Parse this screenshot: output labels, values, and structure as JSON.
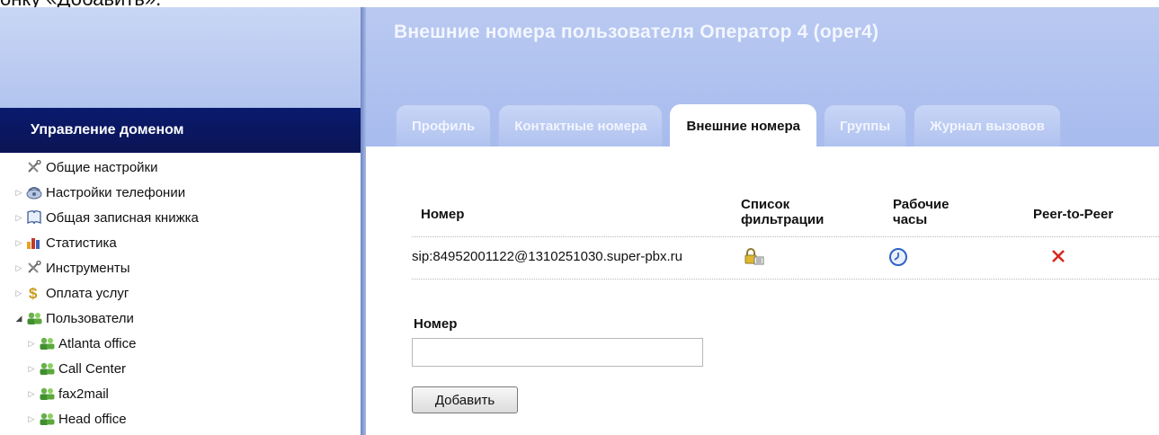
{
  "caption": "онку «Добавить».",
  "sidebar": {
    "header": "Управление доменом",
    "items": [
      {
        "label": "Общие настройки",
        "icon": "tools-icon",
        "arrow": "",
        "indent": 0
      },
      {
        "label": "Настройки телефонии",
        "icon": "telephony-icon",
        "arrow": "collapsed",
        "indent": 0
      },
      {
        "label": "Общая записная книжка",
        "icon": "address-book-icon",
        "arrow": "collapsed",
        "indent": 0
      },
      {
        "label": "Статистика",
        "icon": "statistics-icon",
        "arrow": "collapsed",
        "indent": 0
      },
      {
        "label": "Инструменты",
        "icon": "tools-icon",
        "arrow": "collapsed",
        "indent": 0
      },
      {
        "label": "Оплата услуг",
        "icon": "dollar-icon",
        "arrow": "collapsed",
        "indent": 0
      },
      {
        "label": "Пользователи",
        "icon": "users-icon",
        "arrow": "expanded",
        "indent": 0
      },
      {
        "label": "Atlanta office",
        "icon": "users-icon",
        "arrow": "collapsed",
        "indent": 1
      },
      {
        "label": "Call Center",
        "icon": "users-icon",
        "arrow": "collapsed",
        "indent": 1
      },
      {
        "label": "fax2mail",
        "icon": "users-icon",
        "arrow": "collapsed",
        "indent": 1
      },
      {
        "label": "Head office",
        "icon": "users-icon",
        "arrow": "collapsed",
        "indent": 1
      }
    ]
  },
  "main": {
    "title": "Внешние номера пользователя Оператор 4 (oper4)",
    "tabs": [
      {
        "label": "Профиль",
        "active": false
      },
      {
        "label": "Контактные номера",
        "active": false
      },
      {
        "label": "Внешние номера",
        "active": true
      },
      {
        "label": "Группы",
        "active": false
      },
      {
        "label": "Журнал вызовов",
        "active": false
      }
    ],
    "table": {
      "columns": {
        "number": "Номер",
        "filter_line1": "Список",
        "filter_line2": "фильтрации",
        "hours_line1": "Рабочие",
        "hours_line2": "часы",
        "p2p": "Peer-to-Peer"
      },
      "rows": [
        {
          "number": "sip:84952001122@1310251030.super-pbx.ru",
          "filter_icon": "lock-icon",
          "hours_icon": "clock-icon",
          "p2p_icon": "cross-icon"
        }
      ]
    },
    "form": {
      "label": "Номер",
      "value": "",
      "placeholder": "",
      "button": "Добавить"
    }
  },
  "colors": {
    "sidebar_header_bg": "#0b1554",
    "banner_bg": "#b2c4ee",
    "tab_text_inactive": "#f2f5ff",
    "cross_red": "#d6281e",
    "clock_blue": "#2f63c6"
  }
}
